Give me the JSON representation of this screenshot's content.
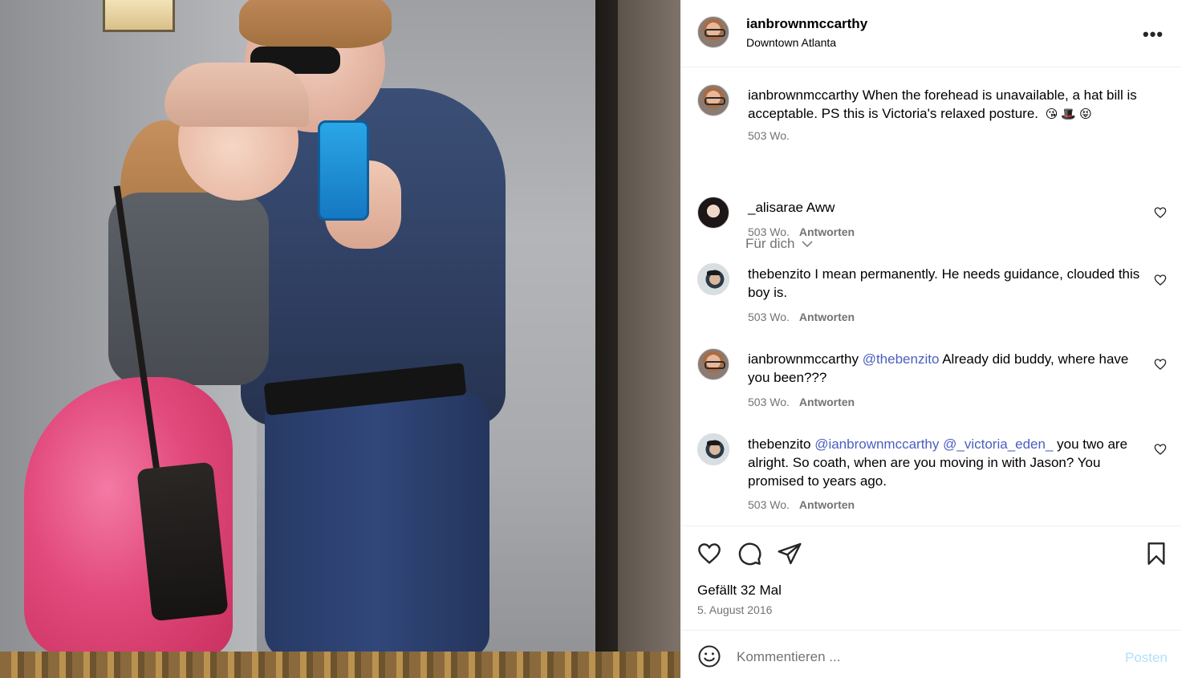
{
  "post": {
    "author": "ianbrownmccarthy",
    "location": "Downtown Atlanta",
    "more_icon": "more-horizontal-icon"
  },
  "caption": {
    "user": "ianbrownmccarthy",
    "text": "When the forehead is unavailable, a hat bill is acceptable. PS this is Victoria's relaxed posture.",
    "emojis": [
      "😘",
      "🎩",
      "😝"
    ],
    "time": "503 Wo."
  },
  "feed_filter": {
    "label": "Für dich"
  },
  "comments": [
    {
      "user": "_alisarae",
      "text": "Aww",
      "time": "503 Wo.",
      "reply": "Antworten"
    },
    {
      "user": "thebenzito",
      "text": "I mean permanently. He needs guidance, clouded this boy is.",
      "time": "503 Wo.",
      "reply": "Antworten"
    },
    {
      "user": "ianbrownmccarthy",
      "mention1": "@thebenzito",
      "text": "Already did buddy, where have you been???",
      "time": "503 Wo.",
      "reply": "Antworten"
    },
    {
      "user": "thebenzito",
      "mention1": "@ianbrownmccarthy",
      "mention2": "@_victoria_eden_",
      "text": "you two are alright. So coath, when are you moving in with Jason? You promised to years ago.",
      "time": "503 Wo.",
      "reply": "Antworten"
    }
  ],
  "stats": {
    "likes": "Gefällt 32 Mal",
    "date": "5. August 2016"
  },
  "composer": {
    "placeholder": "Kommentieren ...",
    "post_label": "Posten"
  },
  "colors": {
    "mention": "#4a5fc1",
    "muted": "#737373",
    "post_disabled": "#b2dffc"
  }
}
